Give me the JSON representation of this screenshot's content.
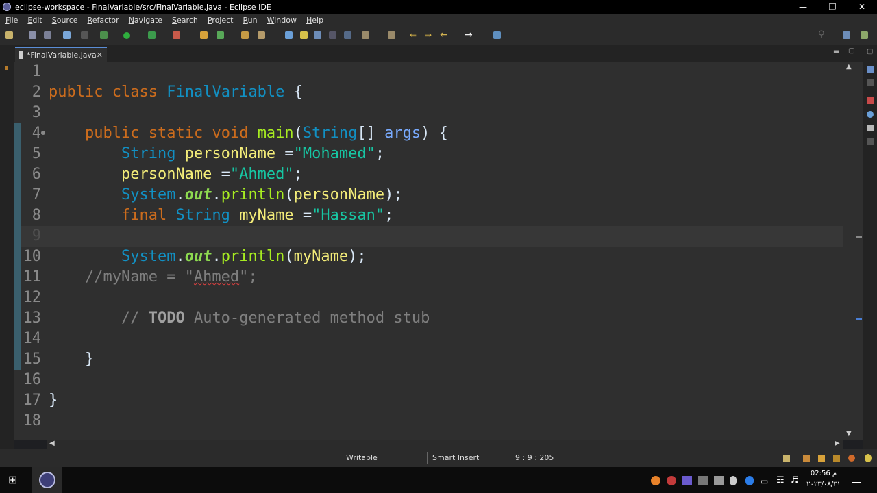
{
  "window": {
    "title": "eclipse-workspace - FinalVariable/src/FinalVariable.java - Eclipse IDE"
  },
  "menu": [
    "File",
    "Edit",
    "Source",
    "Refactor",
    "Navigate",
    "Search",
    "Project",
    "Run",
    "Window",
    "Help"
  ],
  "tab": {
    "label": "*FinalVariable.java"
  },
  "lines": [
    {
      "n": "1",
      "tokens": []
    },
    {
      "n": "2",
      "tokens": [
        {
          "c": "kw",
          "t": "public"
        },
        {
          "c": "",
          "t": " "
        },
        {
          "c": "kw",
          "t": "class"
        },
        {
          "c": "",
          "t": " "
        },
        {
          "c": "ty",
          "t": "FinalVariable"
        },
        {
          "c": "",
          "t": " {"
        }
      ]
    },
    {
      "n": "3",
      "tokens": []
    },
    {
      "n": "4",
      "tokens": [
        {
          "c": "",
          "t": "    "
        },
        {
          "c": "kw",
          "t": "public"
        },
        {
          "c": "",
          "t": " "
        },
        {
          "c": "kw",
          "t": "static"
        },
        {
          "c": "",
          "t": " "
        },
        {
          "c": "kw",
          "t": "void"
        },
        {
          "c": "",
          "t": " "
        },
        {
          "c": "fn",
          "t": "main"
        },
        {
          "c": "",
          "t": "("
        },
        {
          "c": "ty",
          "t": "String"
        },
        {
          "c": "",
          "t": "[] "
        },
        {
          "c": "prm",
          "t": "args"
        },
        {
          "c": "",
          "t": ") {"
        }
      ]
    },
    {
      "n": "5",
      "tokens": [
        {
          "c": "",
          "t": "        "
        },
        {
          "c": "ty",
          "t": "String"
        },
        {
          "c": "",
          "t": " "
        },
        {
          "c": "var",
          "t": "personName"
        },
        {
          "c": "",
          "t": " ="
        },
        {
          "c": "str",
          "t": "\"Mohamed\""
        },
        {
          "c": "",
          "t": ";"
        }
      ]
    },
    {
      "n": "6",
      "tokens": [
        {
          "c": "",
          "t": "        "
        },
        {
          "c": "var",
          "t": "personName"
        },
        {
          "c": "",
          "t": " ="
        },
        {
          "c": "str",
          "t": "\"Ahmed\""
        },
        {
          "c": "",
          "t": ";"
        }
      ]
    },
    {
      "n": "7",
      "tokens": [
        {
          "c": "",
          "t": "        "
        },
        {
          "c": "ty",
          "t": "System"
        },
        {
          "c": "",
          "t": "."
        },
        {
          "c": "fld",
          "t": "out"
        },
        {
          "c": "",
          "t": "."
        },
        {
          "c": "fn",
          "t": "println"
        },
        {
          "c": "",
          "t": "("
        },
        {
          "c": "var",
          "t": "personName"
        },
        {
          "c": "",
          "t": ");"
        }
      ]
    },
    {
      "n": "8",
      "tokens": [
        {
          "c": "",
          "t": "        "
        },
        {
          "c": "kw",
          "t": "final"
        },
        {
          "c": "",
          "t": " "
        },
        {
          "c": "ty",
          "t": "String"
        },
        {
          "c": "",
          "t": " "
        },
        {
          "c": "var",
          "t": "myName"
        },
        {
          "c": "",
          "t": " ="
        },
        {
          "c": "str",
          "t": "\"Hassan\""
        },
        {
          "c": "",
          "t": ";"
        }
      ]
    },
    {
      "n": "9",
      "tokens": [],
      "current": true
    },
    {
      "n": "10",
      "tokens": [
        {
          "c": "",
          "t": "        "
        },
        {
          "c": "ty",
          "t": "System"
        },
        {
          "c": "",
          "t": "."
        },
        {
          "c": "fld",
          "t": "out"
        },
        {
          "c": "",
          "t": "."
        },
        {
          "c": "fn",
          "t": "println"
        },
        {
          "c": "",
          "t": "("
        },
        {
          "c": "var",
          "t": "myName"
        },
        {
          "c": "",
          "t": ");"
        }
      ]
    },
    {
      "n": "11",
      "tokens": [
        {
          "c": "",
          "t": "    "
        },
        {
          "c": "cmt",
          "t": "//myName = \""
        },
        {
          "c": "cmt squig",
          "t": "Ahmed"
        },
        {
          "c": "cmt",
          "t": "\";"
        }
      ]
    },
    {
      "n": "12",
      "tokens": []
    },
    {
      "n": "13",
      "tokens": [
        {
          "c": "",
          "t": "        "
        },
        {
          "c": "cmt",
          "t": "// "
        },
        {
          "c": "todo",
          "t": "TODO"
        },
        {
          "c": "cmt",
          "t": " Auto-generated method stub"
        }
      ]
    },
    {
      "n": "14",
      "tokens": []
    },
    {
      "n": "15",
      "tokens": [
        {
          "c": "",
          "t": "    }"
        }
      ]
    },
    {
      "n": "16",
      "tokens": []
    },
    {
      "n": "17",
      "tokens": [
        {
          "c": "",
          "t": "}"
        }
      ]
    },
    {
      "n": "18",
      "tokens": []
    }
  ],
  "status": {
    "writable": "Writable",
    "insert_mode": "Smart Insert",
    "position": "9 : 9 : 205"
  },
  "clock": {
    "time": "02:56 م",
    "date": "٢٠٢٣/٠٨/٣١"
  },
  "colors": {
    "keyword": "#cc6c1d",
    "type": "#1290c3",
    "string": "#17c6a3",
    "variable": "#f3ec79",
    "comment": "#7f7f7f",
    "background": "#2f2f2f"
  }
}
